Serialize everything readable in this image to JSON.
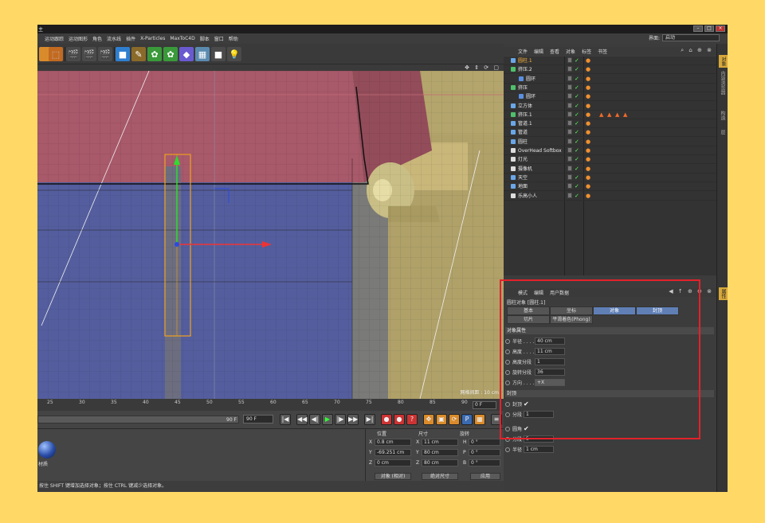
{
  "window": {
    "title": "主"
  },
  "menu": [
    "",
    "运动跟踪",
    "运动图形",
    "角色",
    "流水线",
    "插件",
    "X-Particles",
    "MaxToC4D",
    "脚本",
    "窗口",
    "帮助"
  ],
  "layout": {
    "label": "界面:",
    "value": "启动"
  },
  "viewport": {
    "grid_info": "网格间距 : 10 cm"
  },
  "timeline": {
    "ticks": [
      "25",
      "30",
      "35",
      "40",
      "45",
      "50",
      "55",
      "60",
      "65",
      "70",
      "75",
      "80",
      "85",
      "90"
    ],
    "current_frame": "0 F",
    "scrub_end": "90 F",
    "end_frame": "90 F"
  },
  "material": {
    "name": "材质"
  },
  "coords": {
    "headers": {
      "position": "位置",
      "size": "尺寸",
      "rotation": "旋转"
    },
    "rows": [
      {
        "axis": "X",
        "pos": "0.8 cm",
        "sizeAxis": "X",
        "size": "11 cm",
        "rotAxis": "H",
        "rot": "0 °"
      },
      {
        "axis": "Y",
        "pos": "-69.251 cm",
        "sizeAxis": "Y",
        "size": "80 cm",
        "rotAxis": "P",
        "rot": "0 °"
      },
      {
        "axis": "Z",
        "pos": "0 cm",
        "sizeAxis": "Z",
        "size": "80 cm",
        "rotAxis": "B",
        "rot": "0 °"
      }
    ],
    "mode_dropdown": "对象 (相对)",
    "size_dropdown": "绝对尺寸",
    "apply": "应用"
  },
  "status": "按住 SHIFT 键增加选择对象；按住 CTRL 键减少选择对象。",
  "object_manager": {
    "menu": [
      "文件",
      "编辑",
      "查看",
      "对象",
      "标签",
      "书签"
    ],
    "objects": [
      {
        "name": "圆柱.1",
        "indent": 0,
        "selected": true,
        "color": "#6aa7e8"
      },
      {
        "name": "挤压.2",
        "indent": 0,
        "selected": false,
        "color": "#4fc06a"
      },
      {
        "name": "圆环",
        "indent": 1,
        "selected": false,
        "color": "#5b8fe0"
      },
      {
        "name": "挤压",
        "indent": 0,
        "selected": false,
        "color": "#4fc06a"
      },
      {
        "name": "圆环",
        "indent": 1,
        "selected": false,
        "color": "#5b8fe0"
      },
      {
        "name": "立方体",
        "indent": 0,
        "selected": false,
        "color": "#6aa7e8"
      },
      {
        "name": "挤压.1",
        "indent": 0,
        "selected": false,
        "color": "#4fc06a"
      },
      {
        "name": "管道.1",
        "indent": 0,
        "selected": false,
        "color": "#6aa7e8"
      },
      {
        "name": "管道",
        "indent": 0,
        "selected": false,
        "color": "#6aa7e8"
      },
      {
        "name": "圆柱",
        "indent": 0,
        "selected": false,
        "color": "#6aa7e8"
      },
      {
        "name": "OverHead Softbox",
        "indent": 0,
        "selected": false,
        "color": "#ddd"
      },
      {
        "name": "灯光",
        "indent": 0,
        "selected": false,
        "color": "#ddd"
      },
      {
        "name": "摄像机",
        "indent": 0,
        "selected": false,
        "color": "#ddd"
      },
      {
        "name": "天空",
        "indent": 0,
        "selected": false,
        "color": "#6aa7e8"
      },
      {
        "name": "地面",
        "indent": 0,
        "selected": false,
        "color": "#6aa7e8"
      },
      {
        "name": "乐高小人",
        "indent": 0,
        "selected": false,
        "color": "#ddd"
      }
    ]
  },
  "side_tabs": [
    "对象",
    "内容浏览器",
    "构造",
    "层"
  ],
  "attributes": {
    "menu": [
      "模式",
      "编辑",
      "用户数据"
    ],
    "title": "圆柱对象 [圆柱.1]",
    "tabs_row1": [
      {
        "label": "基本",
        "active": false
      },
      {
        "label": "坐标",
        "active": false
      },
      {
        "label": "对象",
        "active": true
      },
      {
        "label": "封顶",
        "active": true
      }
    ],
    "tabs_row2": [
      "切片",
      "平滑着色(Phong)"
    ],
    "section_object": "对象属性",
    "params": [
      {
        "label": "半径 . . . .",
        "value": "40 cm"
      },
      {
        "label": "高度 . . . .",
        "value": "11 cm"
      },
      {
        "label": "高度分段",
        "value": "1"
      },
      {
        "label": "旋转分段",
        "value": "36"
      },
      {
        "label": "方向 . . . .",
        "value": "+X"
      }
    ],
    "section_caps": "封顶",
    "caps": [
      {
        "label": "封顶",
        "value": "✔"
      },
      {
        "label": "分段",
        "value": "1"
      },
      {
        "label": "圆角",
        "value": "✔"
      },
      {
        "label": "分段",
        "value": "5"
      },
      {
        "label": "半径",
        "value": "1 cm"
      }
    ]
  }
}
